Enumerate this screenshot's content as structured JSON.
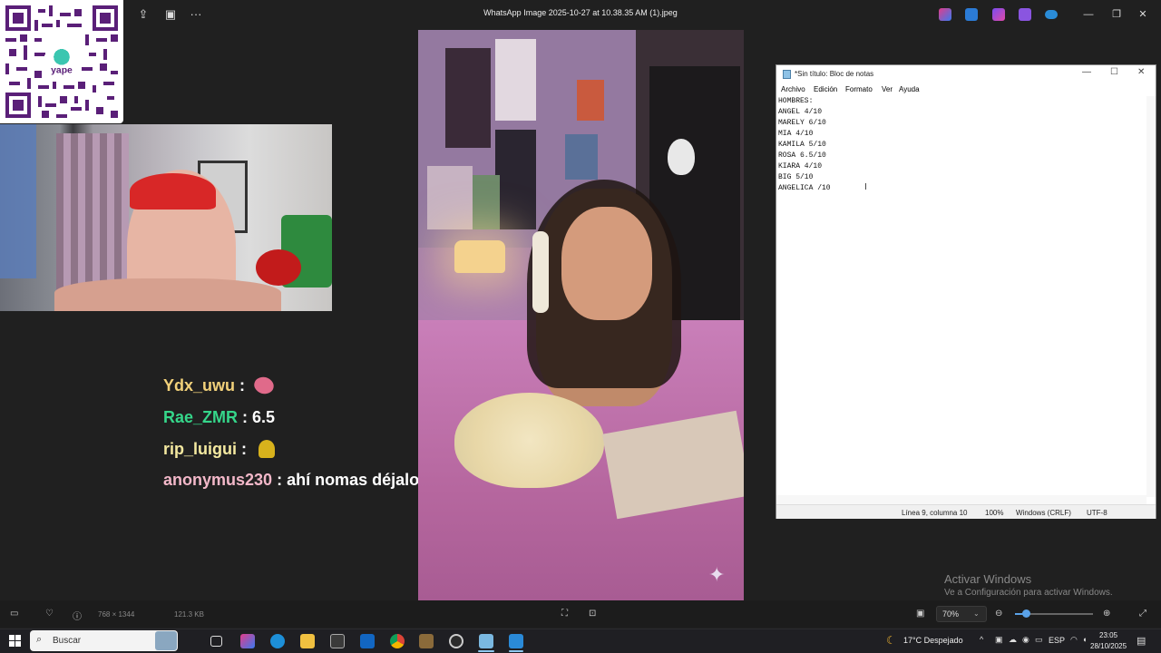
{
  "viewer": {
    "title": "WhatsApp Image 2025-10-27 at 10.38.35 AM (1).jpeg",
    "dimensions": "768 × 1344",
    "filesize": "121.3 KB",
    "zoom": "70%",
    "zoom_level": 0.1
  },
  "qr": {
    "brand": "yape"
  },
  "chat": [
    {
      "user": "Ydx_uwu",
      "sep": " :",
      "message": "",
      "user_color": "#f2d17a",
      "icon": "tongue-sticker-icon"
    },
    {
      "user": "Rae_ZMR",
      "sep": " :",
      "message": " 6.5",
      "user_color": "#35d68a"
    },
    {
      "user": "rip_luigui",
      "sep": " :",
      "message": "",
      "user_color": "#f4e9a0",
      "icon": "bell-sticker-icon"
    },
    {
      "user": "anonymus230",
      "sep": " :",
      "message": " ahí nomas déjalo xD",
      "user_color": "#f3b8c9"
    }
  ],
  "notepad": {
    "title": "*Sin título: Bloc de notas",
    "menu": [
      "Archivo",
      "Edición",
      "Formato",
      "Ver",
      "Ayuda"
    ],
    "lines": [
      "HOMBRES:",
      "ANGEL 4/10",
      "MARELY 6/10",
      "MIA 4/10",
      "KAMILA 5/10",
      "ROSA 6.5/10",
      "KIARA 4/10",
      "BIG 5/10",
      "ANGELICA /10"
    ],
    "status": {
      "position": "Línea 9, columna 10",
      "zoom": "100%",
      "eol": "Windows (CRLF)",
      "encoding": "UTF-8"
    }
  },
  "activation": {
    "title": "Activar Windows",
    "subtitle": "Ve a Configuración para activar Windows."
  },
  "taskbar": {
    "search_placeholder": "Buscar",
    "weather": "17°C  Despejado",
    "lang": "ESP",
    "time": "23:05",
    "date": "28/10/2025"
  }
}
